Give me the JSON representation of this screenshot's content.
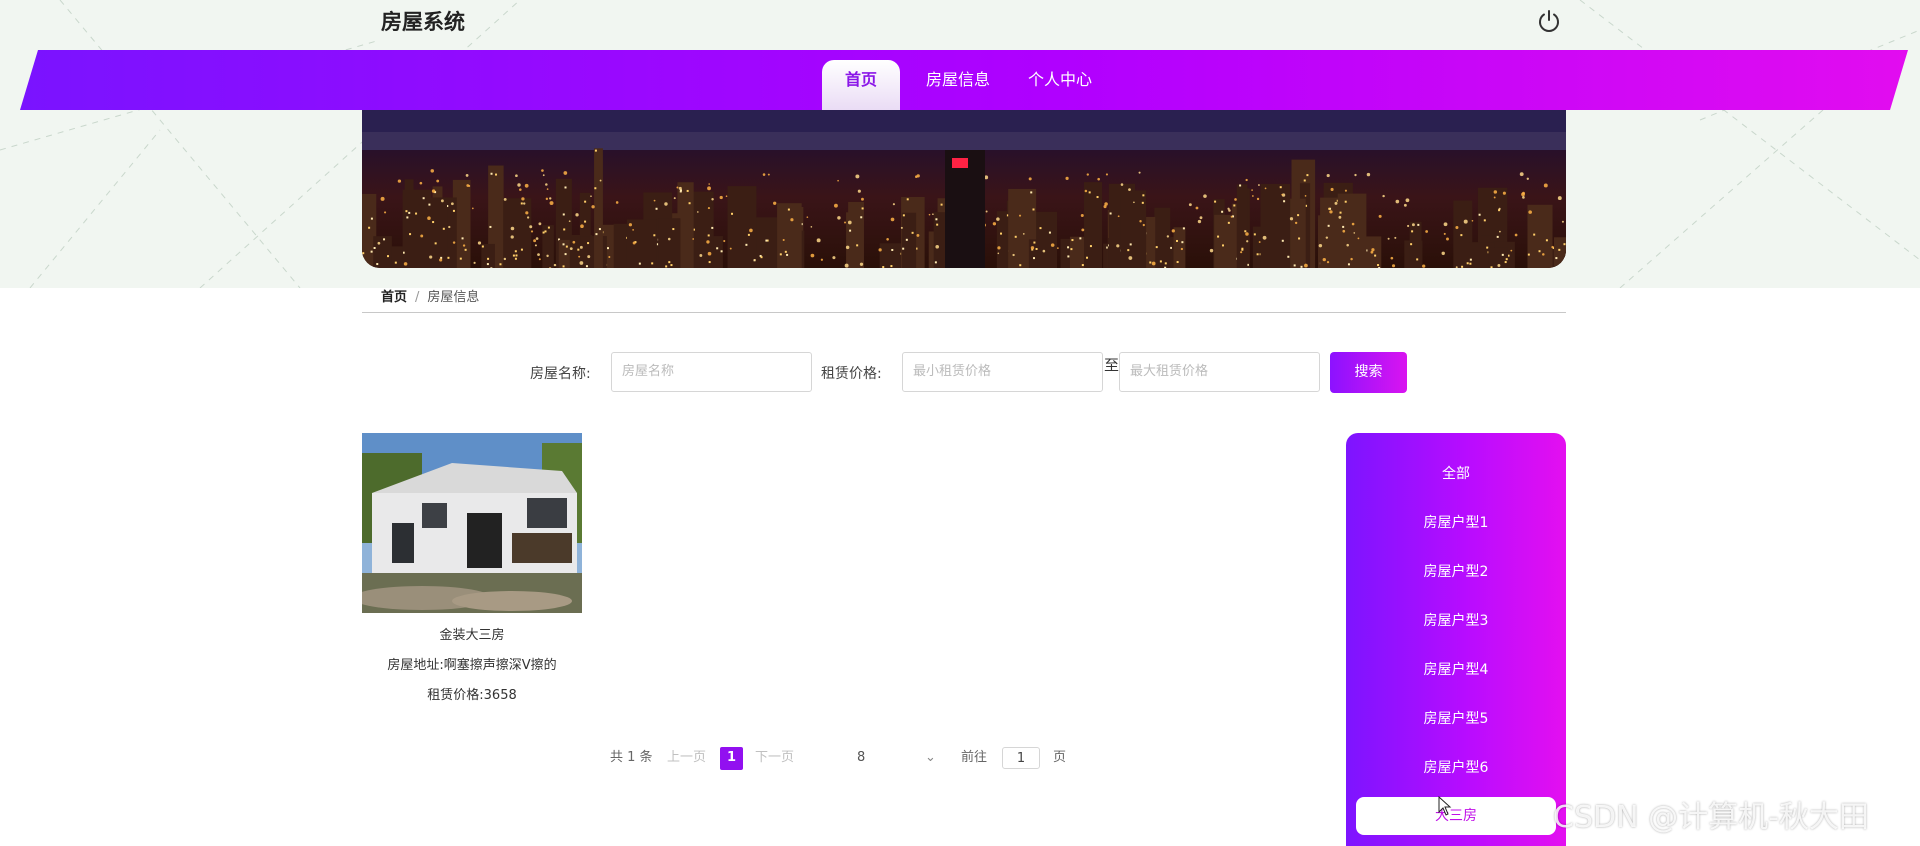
{
  "header": {
    "brand": "房屋系统",
    "power_icon": "power-icon"
  },
  "nav": {
    "items": [
      {
        "label": "首页",
        "active": true
      },
      {
        "label": "房屋信息",
        "active": false
      },
      {
        "label": "个人中心",
        "active": false
      }
    ]
  },
  "breadcrumb": {
    "home": "首页",
    "separator": "/",
    "current": "房屋信息"
  },
  "search": {
    "name_label": "房屋名称:",
    "name_placeholder": "房屋名称",
    "price_label": "租赁价格:",
    "min_placeholder": "最小租赁价格",
    "to_label": "至",
    "max_placeholder": "最大租赁价格",
    "button": "搜索"
  },
  "listings": [
    {
      "title": "金装大三房",
      "address": "房屋地址:啊塞擦声擦深V擦的",
      "price": "租赁价格:3658"
    }
  ],
  "pagination": {
    "total": "共 1 条",
    "prev": "上一页",
    "current_page": "1",
    "next": "下一页",
    "page_size": "8",
    "goto_label": "前往",
    "goto_value": "1",
    "page_suffix": "页"
  },
  "categories": [
    {
      "label": "全部",
      "active": false
    },
    {
      "label": "房屋户型1",
      "active": false
    },
    {
      "label": "房屋户型2",
      "active": false
    },
    {
      "label": "房屋户型3",
      "active": false
    },
    {
      "label": "房屋户型4",
      "active": false
    },
    {
      "label": "房屋户型5",
      "active": false
    },
    {
      "label": "房屋户型6",
      "active": false
    },
    {
      "label": "大三房",
      "active": true
    }
  ],
  "watermark": "CSDN @计算机-秋大田",
  "colors": {
    "accent_start": "#7a13ff",
    "accent_end": "#e20cf0",
    "page_active": "#9210f0"
  }
}
